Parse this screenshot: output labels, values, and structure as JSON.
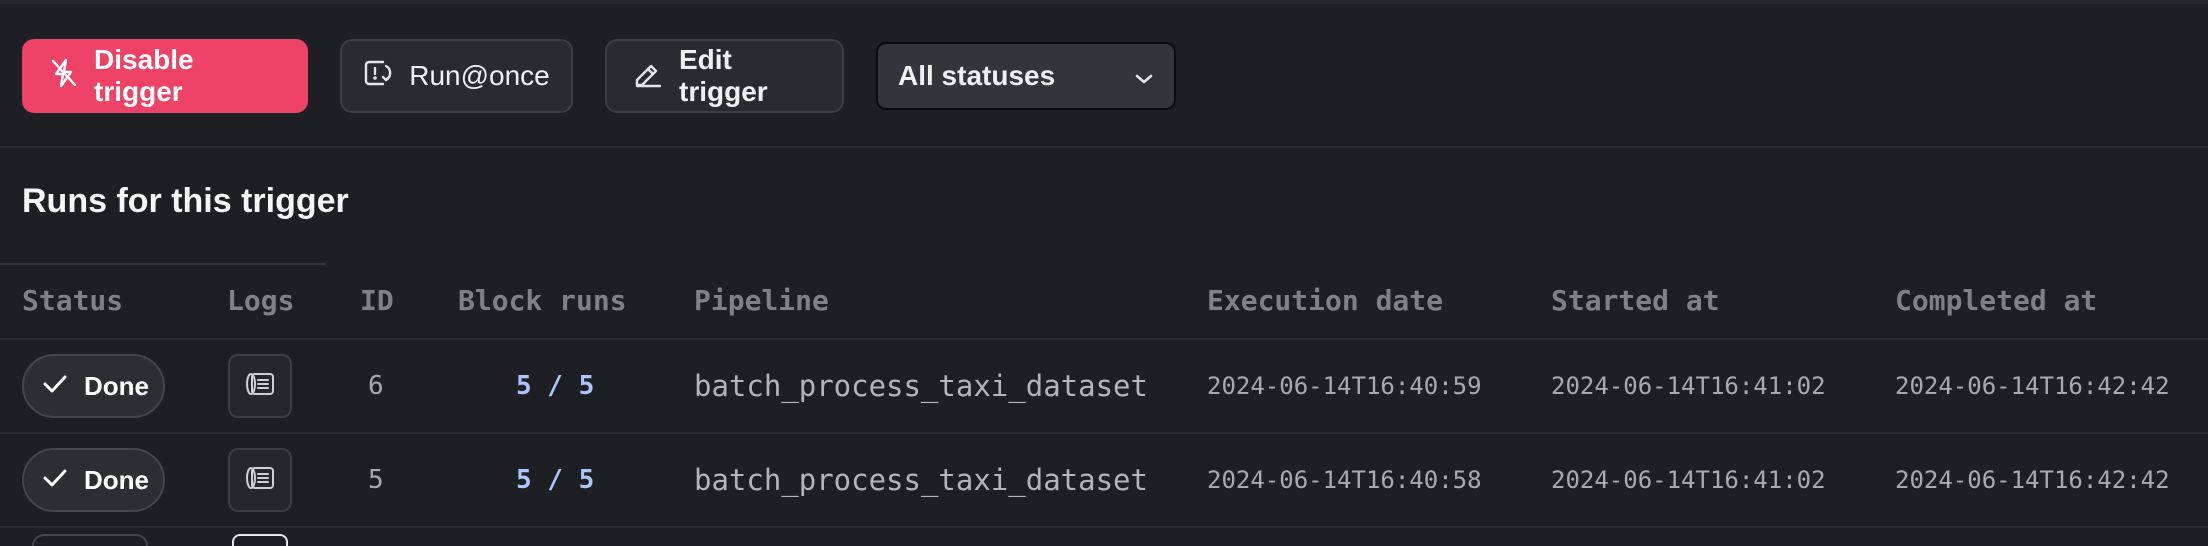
{
  "toolbar": {
    "disable_label": "Disable trigger",
    "run_once_label": "Run@once",
    "edit_label": "Edit trigger",
    "status_filter": "All statuses",
    "icons": {
      "disable": "bolt-off-icon",
      "run_once": "run-once-icon",
      "edit": "pencil-icon",
      "dropdown": "chevron-down-icon"
    }
  },
  "section_title": "Runs for this trigger",
  "colors": {
    "danger": "#ee4266",
    "background": "#1e1f24",
    "block_runs": "#a8c7ff"
  },
  "table": {
    "headers": [
      "Status",
      "Logs",
      "ID",
      "Block runs",
      "Pipeline",
      "Execution date",
      "Started at",
      "Completed at"
    ],
    "rows": [
      {
        "status": "Done",
        "id": "6",
        "block_runs": "5 / 5",
        "pipeline": "batch_process_taxi_dataset",
        "execution_date": "2024-06-14T16:40:59",
        "started_at": "2024-06-14T16:41:02",
        "completed_at": "2024-06-14T16:42:42"
      },
      {
        "status": "Done",
        "id": "5",
        "block_runs": "5 / 5",
        "pipeline": "batch_process_taxi_dataset",
        "execution_date": "2024-06-14T16:40:58",
        "started_at": "2024-06-14T16:41:02",
        "completed_at": "2024-06-14T16:42:42"
      }
    ]
  }
}
